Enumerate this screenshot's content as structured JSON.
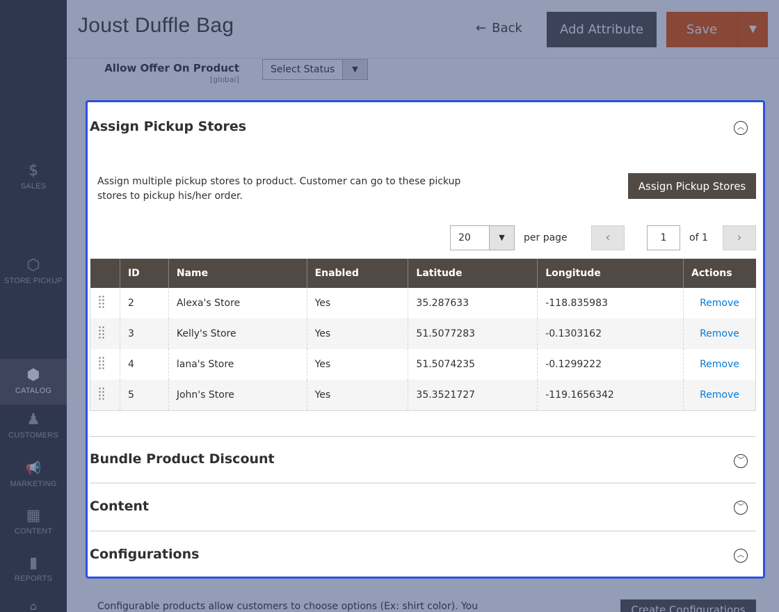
{
  "sidebar": {
    "items": [
      {
        "name": "sales",
        "label": "SALES",
        "icon": "$"
      },
      {
        "name": "store-pickup",
        "label": "STORE PICKUP",
        "icon": "⬡"
      },
      {
        "name": "catalog",
        "label": "CATALOG",
        "icon": "⬢"
      },
      {
        "name": "customers",
        "label": "CUSTOMERS",
        "icon": "♟"
      },
      {
        "name": "marketing",
        "label": "MARKETING",
        "icon": "📢"
      },
      {
        "name": "content",
        "label": "CONTENT",
        "icon": "▦"
      },
      {
        "name": "reports",
        "label": "REPORTS",
        "icon": "▮"
      }
    ]
  },
  "header": {
    "title": "Joust Duffle Bag",
    "back_label": "Back",
    "add_attribute_label": "Add Attribute",
    "save_label": "Save"
  },
  "offer": {
    "label": "Allow Offer On Product",
    "scope": "[global]",
    "select_value": "Select Status"
  },
  "pickup": {
    "title": "Assign Pickup Stores",
    "description": "Assign multiple pickup stores to product. Customer can go to these pickup stores to pickup his/her order.",
    "assign_button": "Assign Pickup Stores",
    "per_page_value": "20",
    "per_page_label": "per page",
    "page_value": "1",
    "page_of": "of 1",
    "columns": [
      "",
      "ID",
      "Name",
      "Enabled",
      "Latitude",
      "Longitude",
      "Actions"
    ],
    "rows": [
      {
        "id": "2",
        "name": "Alexa's Store",
        "enabled": "Yes",
        "lat": "35.287633",
        "lng": "-118.835983",
        "action": "Remove"
      },
      {
        "id": "3",
        "name": "Kelly's Store",
        "enabled": "Yes",
        "lat": "51.5077283",
        "lng": "-0.1303162",
        "action": "Remove"
      },
      {
        "id": "4",
        "name": "lana's Store",
        "enabled": "Yes",
        "lat": "51.5074235",
        "lng": "-0.1299222",
        "action": "Remove"
      },
      {
        "id": "5",
        "name": "John's Store",
        "enabled": "Yes",
        "lat": "35.3521727",
        "lng": "-119.1656342",
        "action": "Remove"
      }
    ]
  },
  "sections": [
    {
      "title": "Bundle Product Discount"
    },
    {
      "title": "Content"
    },
    {
      "title": "Configurations"
    }
  ],
  "bottom": {
    "text": "Configurable products allow customers to choose options (Ex: shirt color). You",
    "button": "Create Configurations"
  },
  "colors": {
    "sidebar_bg": "#373330",
    "primary_dark": "#514943",
    "save_orange": "#eb5202",
    "link_blue": "#007bdb",
    "focus_border": "#2e4fe0"
  }
}
